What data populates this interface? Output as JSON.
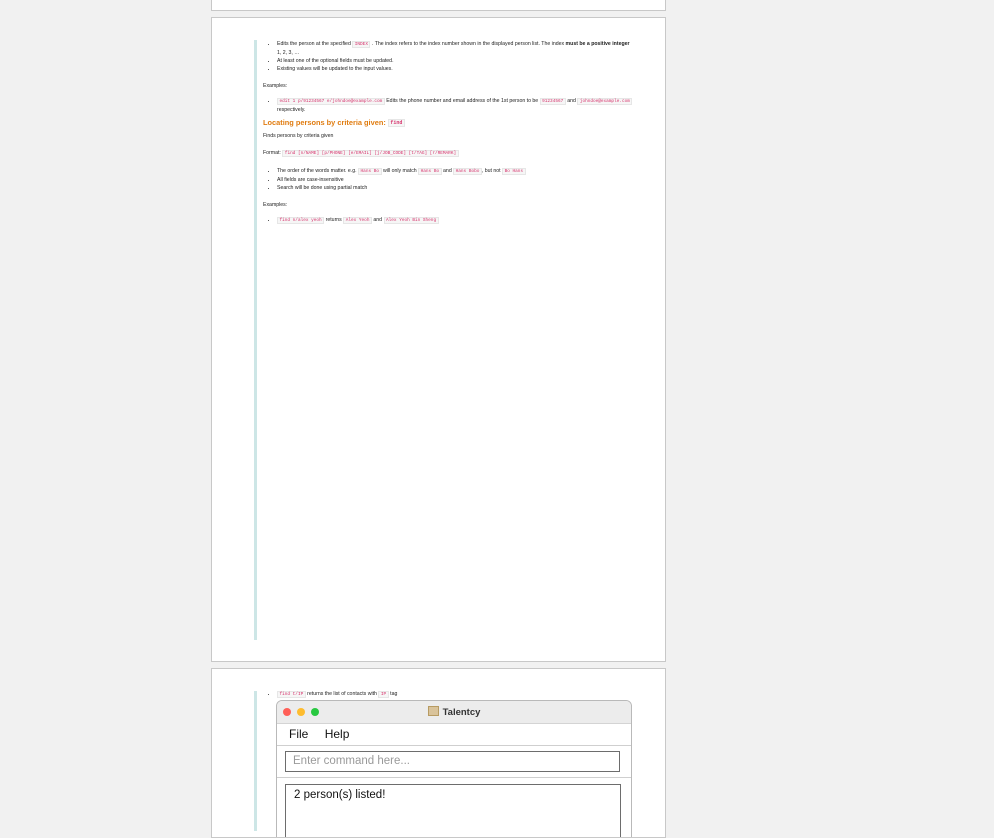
{
  "edit_section": {
    "bullet1_a": "Edits the person at the specified",
    "bullet1_code": "INDEX",
    "bullet1_b": ". The index refers to the index number shown in the displayed person list. The index",
    "bullet1_bold": "must be a positive integer",
    "bullet1_c": "1, 2, 3, …",
    "bullet2": "At least one of the optional fields must be updated.",
    "bullet3": "Existing values will be updated to the input values.",
    "examples_label": "Examples:",
    "example_code": "edit 1 p/91234567 e/johndoe@example.com",
    "example_text_a": "Edits the phone number and email address of the 1st person to be",
    "example_code2": "91234567",
    "example_text_b": "and",
    "example_code3": "johndoe@example.com",
    "example_text_c": "respectively."
  },
  "find_section": {
    "heading": "Locating persons by criteria given:",
    "heading_code": "find",
    "description": "Finds persons by criteria given",
    "format_label": "Format:",
    "format_code": "find [n/NAME] [p/PHONE] [e/EMAIL] [j/JOB_CODE] [t/TAG] [r/REMARK]",
    "bullet1_a": "The order of the words matter. e.g.",
    "bullet1_code1": "Hans Bo",
    "bullet1_b": "will only match",
    "bullet1_code2": "Hans Bo",
    "bullet1_c": "and",
    "bullet1_code3": "Hans Bobo",
    "bullet1_d": ", but not",
    "bullet1_code4": "Bo Hans",
    "bullet2": "All fields are case-insensitive",
    "bullet3": "Search will be done using partial match",
    "examples_label": "Examples:",
    "example1_code": "find n/alex yeoh",
    "example1_a": "returns",
    "example1_code2": "Alex Yeoh",
    "example1_b": "and",
    "example1_code3": "Alex Yeoh Bin Sheng"
  },
  "page3": {
    "example2_code": "find t/IP",
    "example2_a": "returns the list of contacts with",
    "example2_code2": "IP",
    "example2_b": "tag"
  },
  "app_window": {
    "title": "Talentcy",
    "menu": [
      "File",
      "Help"
    ],
    "command_placeholder": "Enter command here...",
    "result_text": "2 person(s) listed!"
  },
  "colors": {
    "heading": "#e07c10",
    "code": "#d6336c",
    "quote_bar": "#cde6e6"
  }
}
